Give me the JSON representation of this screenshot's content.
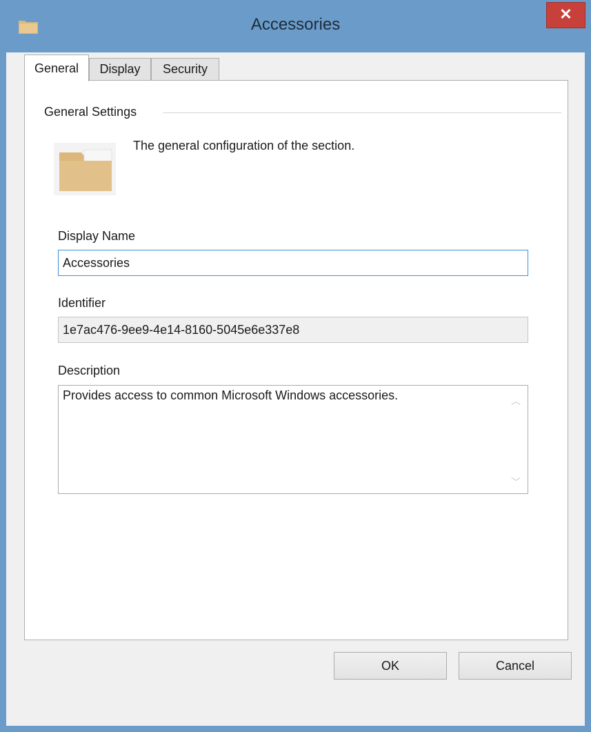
{
  "window": {
    "title": "Accessories",
    "close_label": "✕"
  },
  "tabs": [
    {
      "label": "General",
      "active": true
    },
    {
      "label": "Display",
      "active": false
    },
    {
      "label": "Security",
      "active": false
    }
  ],
  "general": {
    "group_title": "General Settings",
    "description": "The general configuration of the section.",
    "display_name_label": "Display Name",
    "display_name_value": "Accessories",
    "identifier_label": "Identifier",
    "identifier_value": "1e7ac476-9ee9-4e14-8160-5045e6e337e8",
    "description_label": "Description",
    "description_value": "Provides access to common Microsoft Windows accessories."
  },
  "buttons": {
    "ok_label": "OK",
    "cancel_label": "Cancel"
  },
  "icons": {
    "title_icon": "folder-icon",
    "section_icon": "folder-icon",
    "scroll_up": "chevron-up-icon",
    "scroll_down": "chevron-down-icon"
  },
  "colors": {
    "titlebar": "#6a9bc9",
    "close": "#c7413a",
    "folder": "#dcb67a",
    "focus_border": "#3c8fd7"
  }
}
